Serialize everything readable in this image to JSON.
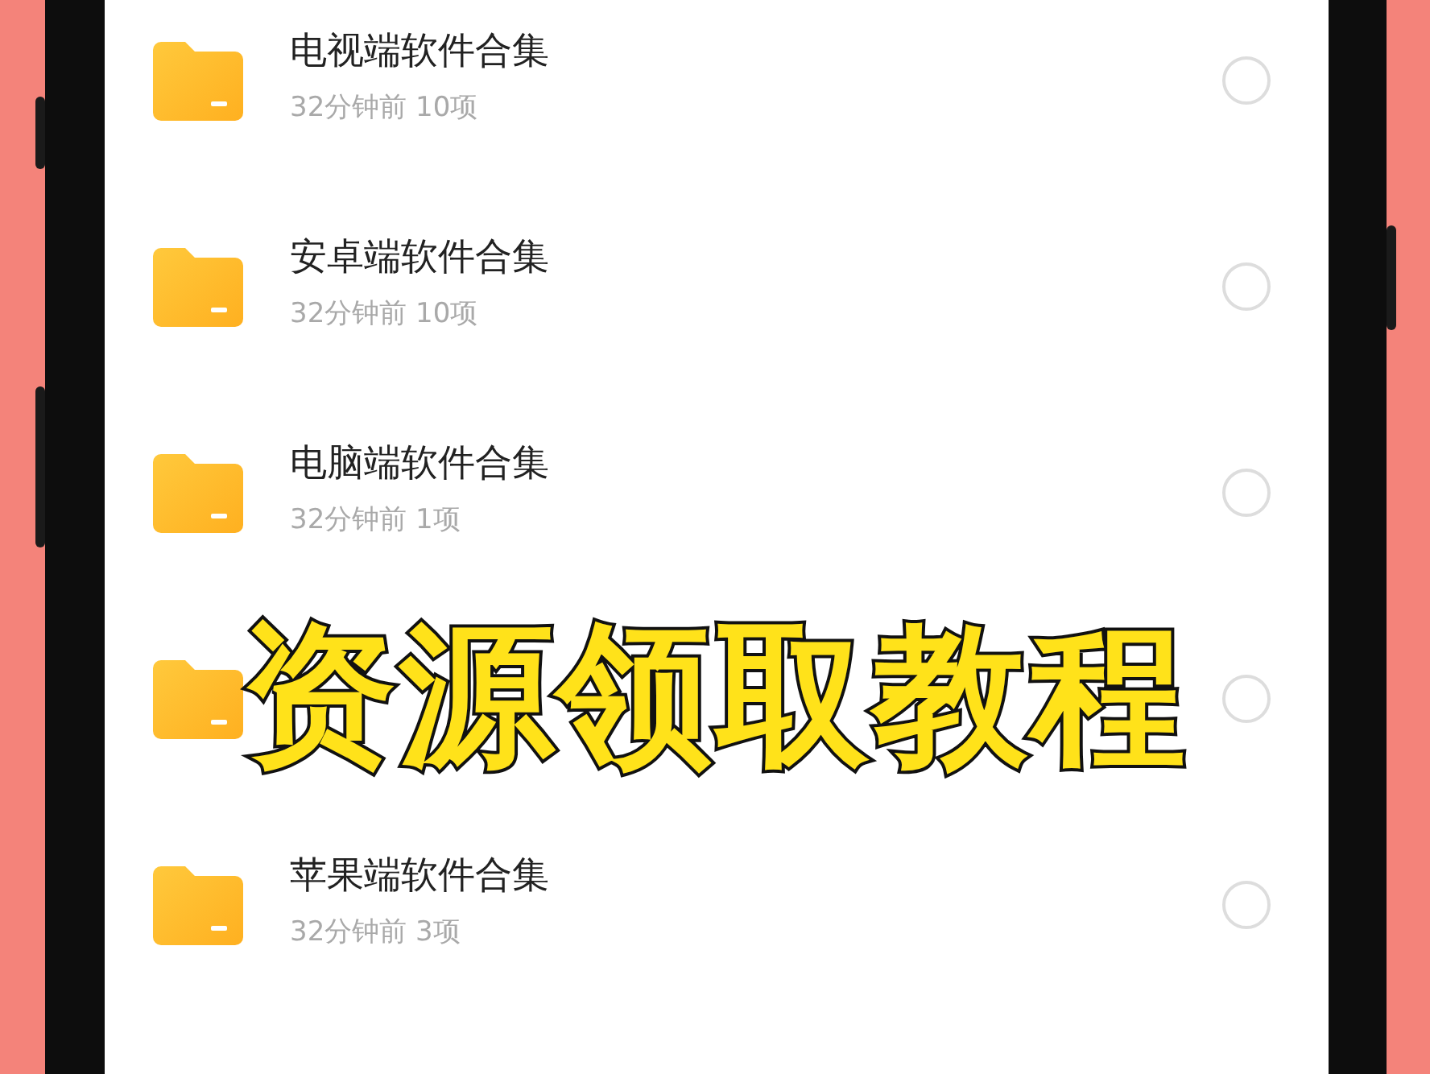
{
  "files": [
    {
      "title": "电视端软件合集",
      "meta": "32分钟前 10项",
      "selected": false
    },
    {
      "title": "安卓端软件合集",
      "meta": "32分钟前 10项",
      "selected": false
    },
    {
      "title": "电脑端软件合集",
      "meta": "32分钟前 1项",
      "selected": false
    },
    {
      "selected": false
    },
    {
      "title": "苹果端软件合集",
      "meta": "32分钟前 3项",
      "selected": false
    }
  ],
  "overlay_title": "资源领取教程"
}
